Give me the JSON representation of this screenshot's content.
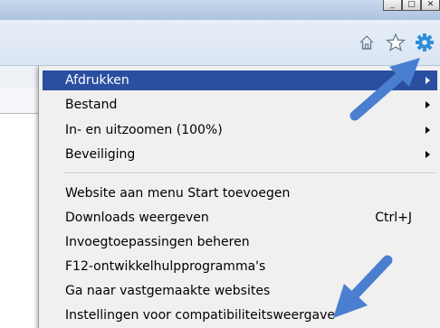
{
  "window": {
    "controls": [
      "_",
      "□",
      "✕"
    ]
  },
  "toolbar": {
    "icons": [
      "home-icon",
      "favorites-star-icon",
      "tools-gear-icon"
    ]
  },
  "menu": {
    "submenu_items": [
      {
        "label": "Afdrukken",
        "selected": true
      },
      {
        "label": "Bestand"
      },
      {
        "label": "In- en uitzoomen (100%)"
      },
      {
        "label": "Beveiliging"
      }
    ],
    "items": [
      {
        "label": "Website aan menu Start toevoegen"
      },
      {
        "label": "Downloads weergeven",
        "shortcut": "Ctrl+J"
      },
      {
        "label": "Invoegtoepassingen beheren"
      },
      {
        "label": "F12-ontwikkelhulpprogramma's"
      },
      {
        "label": "Ga naar vastgemaakte websites"
      },
      {
        "label": "Instellingen voor compatibiliteitsweergave"
      }
    ]
  },
  "colors": {
    "selection": "#2a4fa0",
    "callout_arrow": "#4a7fd0"
  }
}
